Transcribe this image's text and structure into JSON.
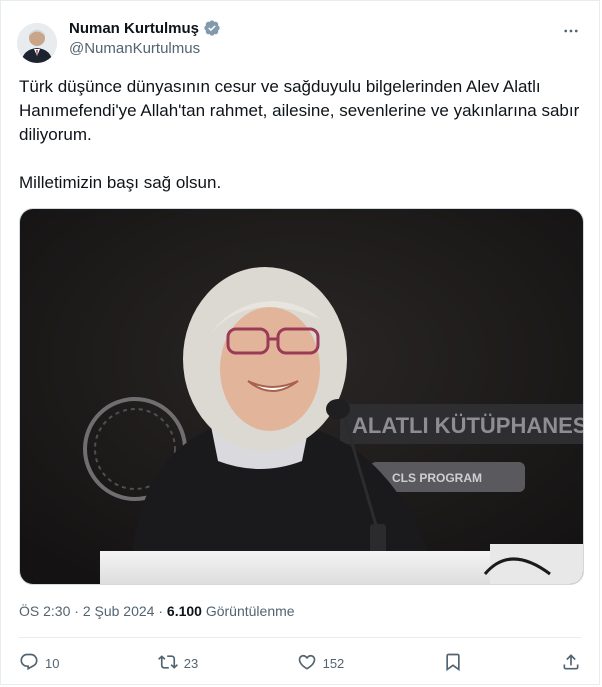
{
  "author": {
    "display_name": "Numan Kurtulmuş",
    "handle": "@NumanKurtulmus",
    "verified_icon": "verified-badge-icon"
  },
  "tweet": {
    "line1": "Türk düşünce dünyasının cesur ve sağduyulu bilgelerinden Alev Alatlı Hanımefendi'ye Allah'tan rahmet, ailesine, sevenlerine ve yakınlarına sabır diliyorum.",
    "line2": "Milletimizin başı sağ olsun."
  },
  "photo": {
    "backdrop_text_1": "ALATLI KÜTÜPHANESİ",
    "backdrop_text_2": "CLS PROGRAM"
  },
  "meta": {
    "time": "ÖS 2:30",
    "separator": "·",
    "date": "2 Şub 2024",
    "views_count": "6.100",
    "views_label": "Görüntülenme"
  },
  "actions": {
    "reply_count": "10",
    "retweet_count": "23",
    "like_count": "152"
  },
  "colors": {
    "verified": "#829aab",
    "text": "#0f1419",
    "secondary": "#536471"
  }
}
